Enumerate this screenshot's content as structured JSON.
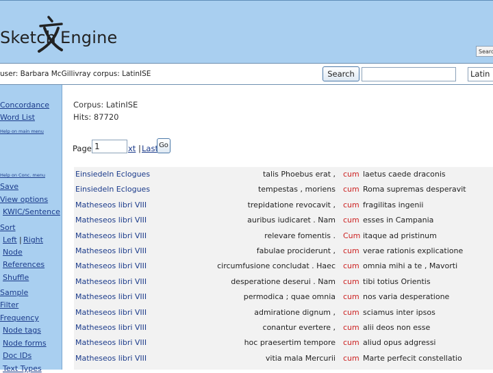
{
  "header": {
    "logo_word_1": "Sketch",
    "logo_word_2": "Engine",
    "logo_glyph": "文",
    "top_search_label": "Search"
  },
  "userbar": {
    "user_text": "user: Barbara McGillivray corpus: LatinISE",
    "search_button": "Search",
    "search_value": "",
    "language": "Latin"
  },
  "sidebar": {
    "items": [
      {
        "label": "Concordance",
        "size": "big"
      },
      {
        "label": "Word List",
        "size": "big"
      },
      {
        "label": "Help on main menu",
        "size": "small"
      },
      {
        "label": "Help on Conc. menu",
        "size": "small"
      },
      {
        "label": "Save",
        "size": "big"
      },
      {
        "label": "View options",
        "size": "big"
      },
      {
        "label": "KWIC/Sentence",
        "size": "big"
      },
      {
        "label": "Sort",
        "size": "big"
      },
      {
        "label": "Left",
        "size": "big"
      },
      {
        "label": "Right",
        "size": "big"
      },
      {
        "label": "Node",
        "size": "big"
      },
      {
        "label": "References",
        "size": "big"
      },
      {
        "label": "Shuffle",
        "size": "big"
      },
      {
        "label": "Sample",
        "size": "big"
      },
      {
        "label": "Filter",
        "size": "big"
      },
      {
        "label": "Frequency",
        "size": "big"
      },
      {
        "label": "Node tags",
        "size": "big"
      },
      {
        "label": "Node forms",
        "size": "big"
      },
      {
        "label": "Doc IDs",
        "size": "big"
      },
      {
        "label": "Text Types",
        "size": "big"
      }
    ],
    "separator": "|"
  },
  "main": {
    "corpus_line": "Corpus: LatinISE",
    "hits_line": "Hits: 87720",
    "page_label": "Page",
    "page_value": "1",
    "next_label": "xt",
    "separator": "|",
    "last_label": "Last",
    "go_label": "Go"
  },
  "concordance": {
    "rows": [
      {
        "doc": "Einsiedeln Eclogues",
        "left": "talis Phoebus erat ,",
        "kwic": "cum",
        "right": "laetus caede draconis"
      },
      {
        "doc": "Einsiedeln Eclogues",
        "left": "tempestas , moriens",
        "kwic": "cum",
        "right": "Roma supremas desperavit"
      },
      {
        "doc": "Matheseos libri VIII",
        "left": "trepidatione revocavit ,",
        "kwic": "cum",
        "right": "fragilitas ingenii"
      },
      {
        "doc": "Matheseos libri VIII",
        "left": "auribus iudicaret . Nam",
        "kwic": "cum",
        "right": "esses in Campania"
      },
      {
        "doc": "Matheseos libri VIII",
        "left": "relevare fomentis .",
        "kwic": "Cum",
        "right": "itaque ad pristinum"
      },
      {
        "doc": "Matheseos libri VIII",
        "left": "fabulae prociderunt ,",
        "kwic": "cum",
        "right": "verae rationis explicatione"
      },
      {
        "doc": "Matheseos libri VIII",
        "left": "circumfusione concludat . Haec",
        "kwic": "cum",
        "right": "omnia mihi a te , Mavorti"
      },
      {
        "doc": "Matheseos libri VIII",
        "left": "desperatione deserui . Nam",
        "kwic": "cum",
        "right": "tibi totius Orientis"
      },
      {
        "doc": "Matheseos libri VIII",
        "left": "permodica ; quae omnia",
        "kwic": "cum",
        "right": "nos varia desperatione"
      },
      {
        "doc": "Matheseos libri VIII",
        "left": "admiratione dignum ,",
        "kwic": "cum",
        "right": "sciamus inter ipsos"
      },
      {
        "doc": "Matheseos libri VIII",
        "left": "conantur evertere ,",
        "kwic": "cum",
        "right": "alii deos non esse"
      },
      {
        "doc": "Matheseos libri VIII",
        "left": "hoc praesertim tempore",
        "kwic": "cum",
        "right": "aliud opus adgressi"
      },
      {
        "doc": "Matheseos libri VIII",
        "left": "vitia mala Mercurii",
        "kwic": "cum",
        "right": "Marte perfecit constellatio"
      }
    ]
  },
  "colors": {
    "header_bg": "#a9cff0",
    "link": "#1a3a8a",
    "kwic": "#cc2020"
  }
}
